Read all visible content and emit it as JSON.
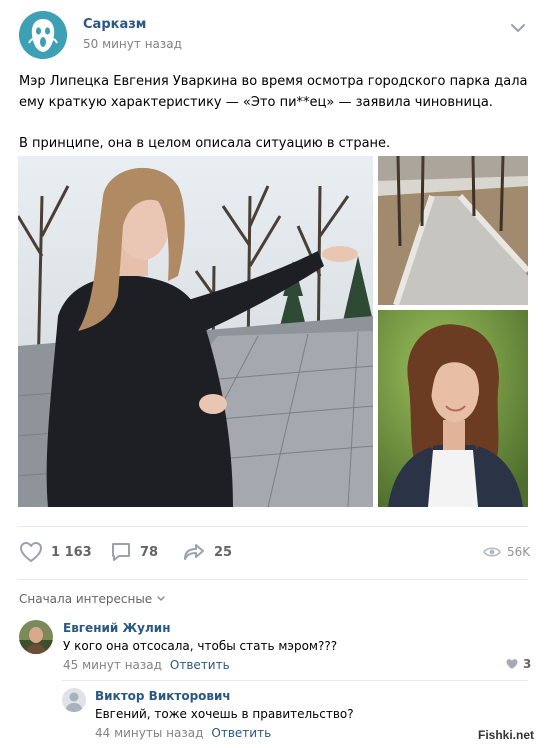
{
  "post": {
    "group_name": "Сарказм",
    "time": "50 минут назад",
    "text_p1": "Мэр Липецка Евгения Уваркина во время осмотра городского парка дала ему краткую характеристику — «Это пи**ец» — заявила чиновница.",
    "text_p2": "В принципе, она в целом описала ситуацию в стране."
  },
  "actions": {
    "likes": "1 163",
    "comments": "78",
    "shares": "25",
    "views": "56K"
  },
  "comments_section": {
    "sort_label": "Сначала интересные",
    "items": [
      {
        "author": "Евгений Жулин",
        "text": "У кого она отсосала, чтобы стать мэром???",
        "time": "45 минут назад",
        "reply_label": "Ответить",
        "likes": "3"
      },
      {
        "author": "Виктор Викторович",
        "text": "Евгений, тоже хочешь в правительство?",
        "time": "44 минуты назад",
        "reply_label": "Ответить"
      }
    ]
  },
  "watermark": "Fishki.net",
  "colors": {
    "link": "#2a5885",
    "meta": "#828282",
    "icon": "#99a2ad",
    "divider": "#e7e8ec"
  }
}
